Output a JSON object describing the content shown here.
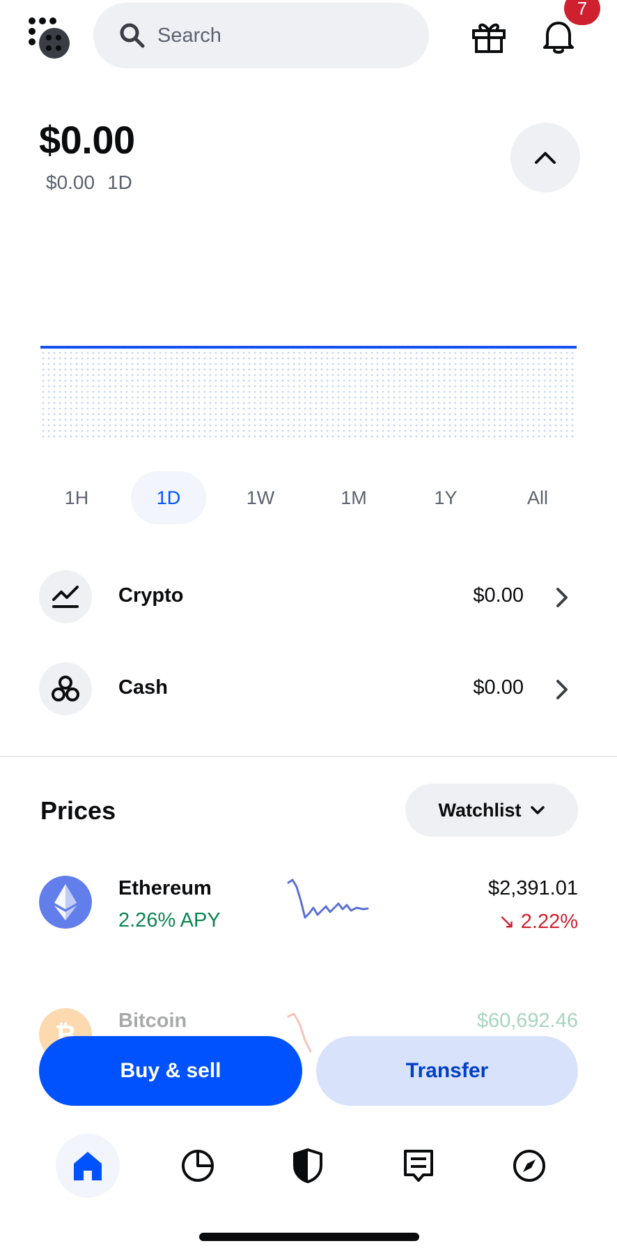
{
  "header": {
    "search_placeholder": "Search",
    "notification_count": "7"
  },
  "balance": {
    "total": "$0.00",
    "change": "$0.00",
    "period": "1D"
  },
  "time_ranges": [
    {
      "label": "1H",
      "active": false
    },
    {
      "label": "1D",
      "active": true
    },
    {
      "label": "1W",
      "active": false
    },
    {
      "label": "1M",
      "active": false
    },
    {
      "label": "1Y",
      "active": false
    },
    {
      "label": "All",
      "active": false
    }
  ],
  "assets": [
    {
      "label": "Crypto",
      "value": "$0.00",
      "icon": "chart-line-icon"
    },
    {
      "label": "Cash",
      "value": "$0.00",
      "icon": "coins-icon"
    }
  ],
  "prices": {
    "title": "Prices",
    "filter_label": "Watchlist",
    "rows": [
      {
        "name": "Ethereum",
        "sub": "2.26% APY",
        "price": "$2,391.01",
        "change": "↘ 2.22%",
        "sub_color": "#098551",
        "change_color": "#cf202f"
      },
      {
        "name": "Bitcoin",
        "price": "$60,692.46"
      }
    ]
  },
  "actions": {
    "buy_sell": "Buy & sell",
    "transfer": "Transfer"
  },
  "nav": [
    "home-icon",
    "portfolio-pie-icon",
    "shield-icon",
    "activity-receipt-icon",
    "explore-compass-icon"
  ],
  "colors": {
    "brand": "#0052ff",
    "chart_line": "#1652f0",
    "negative": "#cf202f",
    "positive": "#098551"
  }
}
